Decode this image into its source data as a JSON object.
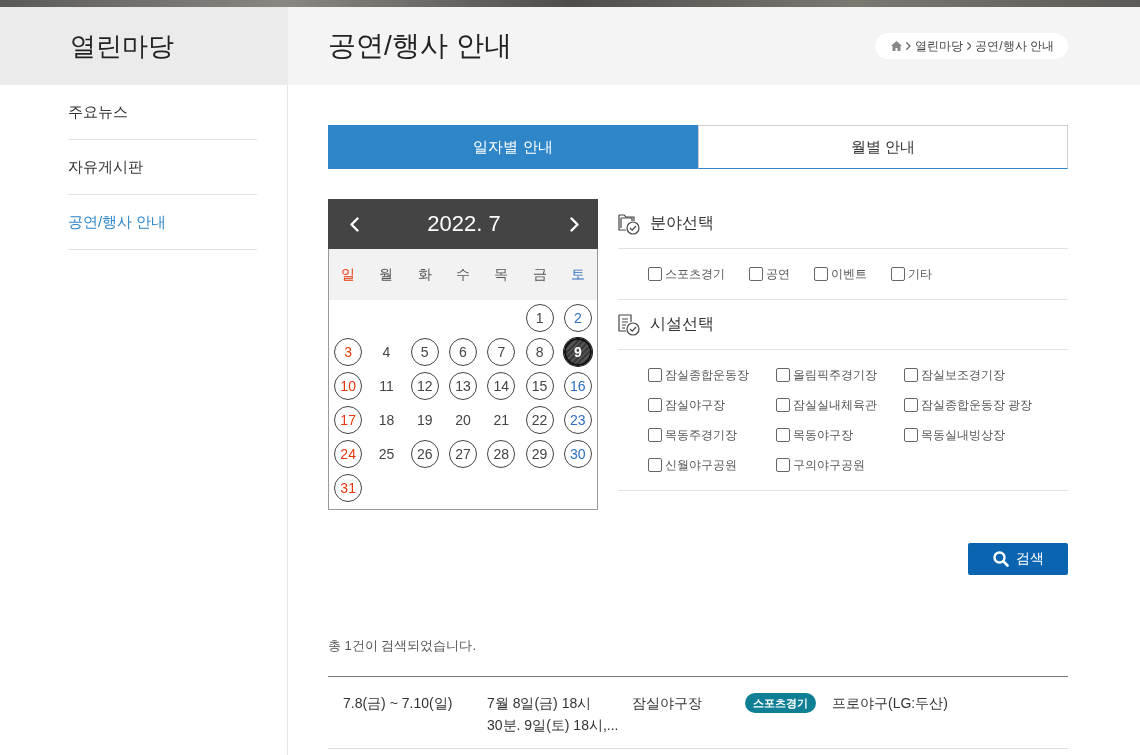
{
  "sidebar": {
    "title": "열린마당",
    "items": [
      {
        "label": "주요뉴스",
        "selected": false
      },
      {
        "label": "자유게시판",
        "selected": false
      },
      {
        "label": "공연/행사 안내",
        "selected": true
      }
    ]
  },
  "page": {
    "title": "공연/행사 안내",
    "breadcrumb": [
      "열린마당",
      "공연/행사 안내"
    ]
  },
  "tabs": [
    {
      "label": "일자별 안내",
      "selected": true
    },
    {
      "label": "월별 안내",
      "selected": false
    }
  ],
  "calendar": {
    "title": "2022. 7",
    "weekdays": [
      "일",
      "월",
      "화",
      "수",
      "목",
      "금",
      "토"
    ],
    "weeks": [
      [
        {
          "day": "1",
          "marked": true,
          "selected": false
        },
        {
          "day": "2",
          "marked": true,
          "selected": false
        }
      ],
      [
        {
          "day": "3",
          "marked": true,
          "selected": false
        },
        {
          "day": "4",
          "marked": false,
          "selected": false
        },
        {
          "day": "5",
          "marked": true,
          "selected": false
        },
        {
          "day": "6",
          "marked": true,
          "selected": false
        },
        {
          "day": "7",
          "marked": true,
          "selected": false
        },
        {
          "day": "8",
          "marked": true,
          "selected": false
        },
        {
          "day": "9",
          "marked": true,
          "selected": true
        }
      ],
      [
        {
          "day": "10",
          "marked": true,
          "selected": false
        },
        {
          "day": "11",
          "marked": false,
          "selected": false
        },
        {
          "day": "12",
          "marked": true,
          "selected": false
        },
        {
          "day": "13",
          "marked": true,
          "selected": false
        },
        {
          "day": "14",
          "marked": true,
          "selected": false
        },
        {
          "day": "15",
          "marked": true,
          "selected": false
        },
        {
          "day": "16",
          "marked": true,
          "selected": false
        }
      ],
      [
        {
          "day": "17",
          "marked": true,
          "selected": false
        },
        {
          "day": "18",
          "marked": false,
          "selected": false
        },
        {
          "day": "19",
          "marked": false,
          "selected": false
        },
        {
          "day": "20",
          "marked": false,
          "selected": false
        },
        {
          "day": "21",
          "marked": false,
          "selected": false
        },
        {
          "day": "22",
          "marked": true,
          "selected": false
        },
        {
          "day": "23",
          "marked": true,
          "selected": false
        }
      ],
      [
        {
          "day": "24",
          "marked": true,
          "selected": false
        },
        {
          "day": "25",
          "marked": false,
          "selected": false
        },
        {
          "day": "26",
          "marked": true,
          "selected": false
        },
        {
          "day": "27",
          "marked": true,
          "selected": false
        },
        {
          "day": "28",
          "marked": true,
          "selected": false
        },
        {
          "day": "29",
          "marked": true,
          "selected": false
        },
        {
          "day": "30",
          "marked": true,
          "selected": false
        }
      ],
      [
        {
          "day": "31",
          "marked": true,
          "selected": false
        }
      ]
    ]
  },
  "filters": [
    {
      "kind": "category",
      "title": "분야선택",
      "options": [
        {
          "label": "스포츠경기",
          "checked": false
        },
        {
          "label": "공연",
          "checked": false
        },
        {
          "label": "이벤트",
          "checked": false
        },
        {
          "label": "기타",
          "checked": false
        }
      ]
    },
    {
      "kind": "facility",
      "title": "시설선택",
      "options": [
        {
          "label": "잠실종합운동장",
          "checked": false
        },
        {
          "label": "올림픽주경기장",
          "checked": false
        },
        {
          "label": "잠실보조경기장",
          "checked": false
        },
        {
          "label": "잠실야구장",
          "checked": false
        },
        {
          "label": "잠실실내체육관",
          "checked": false
        },
        {
          "label": "잠실종합운동장 광장",
          "checked": false
        },
        {
          "label": "목동주경기장",
          "checked": false
        },
        {
          "label": "목동야구장",
          "checked": false
        },
        {
          "label": "목동실내빙상장",
          "checked": false
        },
        {
          "label": "신월야구공원",
          "checked": false
        },
        {
          "label": "구의야구공원",
          "checked": false
        }
      ]
    }
  ],
  "search_button": {
    "label": "검색"
  },
  "result_summary": "총 1건이 검색되었습니다.",
  "results": [
    {
      "period": "7.8(금) ~ 7.10(일)",
      "schedule": "7월 8일(금) 18시 30분. 9일(토) 18시,...",
      "venue": "잠실야구장",
      "category": "스포츠경기",
      "title": "프로야구(LG:두산)"
    }
  ]
}
